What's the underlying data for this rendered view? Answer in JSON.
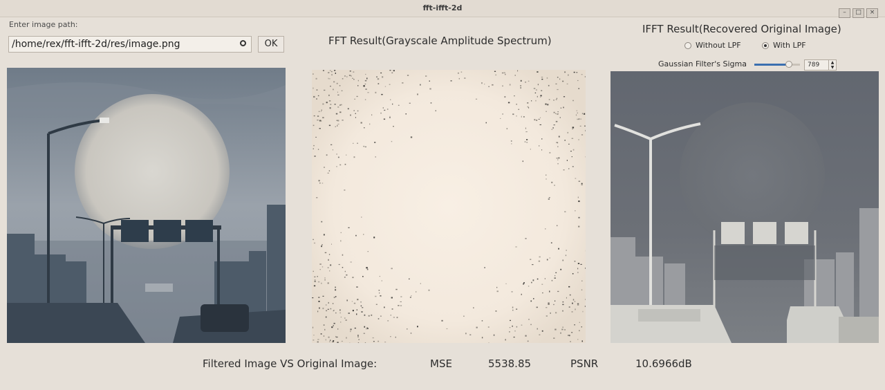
{
  "window": {
    "title": "fft-ifft-2d"
  },
  "input_panel": {
    "label": "Enter image path:",
    "path_value": "/home/rex/fft-ifft-2d/res/image.png",
    "ok_label": "OK"
  },
  "fft_panel": {
    "title": "FFT Result(Grayscale Amplitude Spectrum)"
  },
  "ifft_panel": {
    "title": "IFFT Result(Recovered Original Image)",
    "radio_without": "Without LPF",
    "radio_with": "With LPF",
    "selected": "With LPF",
    "sigma_label": "Gaussian Filter's Sigma",
    "sigma_value": "789",
    "sigma_slider_fraction": 0.75
  },
  "metrics": {
    "label": "Filtered Image VS Original Image:",
    "mse_label": "MSE",
    "mse_value": "5538.85",
    "psnr_label": "PSNR",
    "psnr_value": "10.6966dB"
  },
  "colors": {
    "window_bg": "#e6e0d8",
    "slider_accent": "#3a6fb0"
  }
}
